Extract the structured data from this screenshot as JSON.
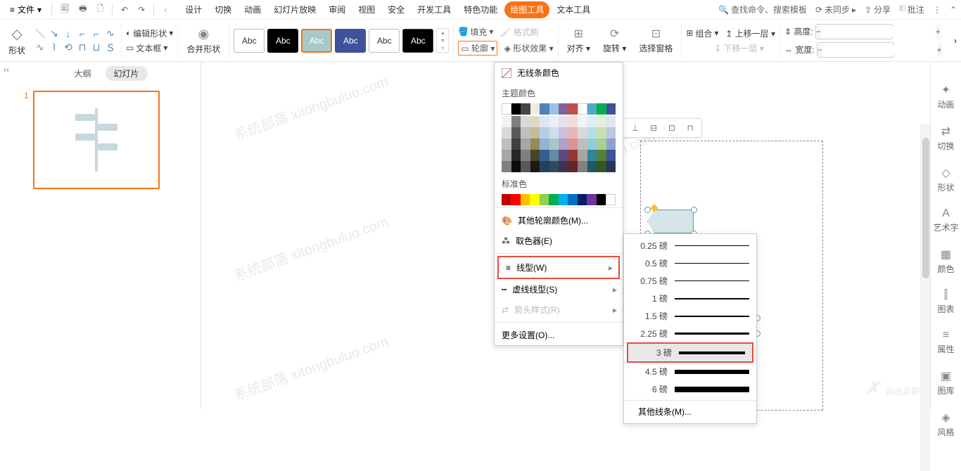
{
  "menubar": {
    "file": "文件",
    "tabs": [
      "设计",
      "切换",
      "动画",
      "幻灯片放映",
      "审阅",
      "视图",
      "安全",
      "开发工具",
      "特色功能",
      "绘图工具",
      "文本工具"
    ],
    "active_tab_index": 9,
    "search": "查找命令、搜索模板",
    "unsynced": "未同步",
    "share": "分享",
    "annotate": "批注"
  },
  "ribbon": {
    "shape_label": "形状",
    "edit_shape": "编辑形状",
    "text_box": "文本框",
    "merge_shapes": "合并形状",
    "style_text": "Abc",
    "fill": "填充",
    "format_painter": "格式刷",
    "outline": "轮廓",
    "shape_effects": "形状效果",
    "align": "对齐",
    "rotate": "旋转",
    "select_pane": "选择窗格",
    "group": "组合",
    "bring_forward": "上移一层",
    "send_backward": "下移一层",
    "height": "高度:",
    "width": "宽度:",
    "height_val": "",
    "width_val": ""
  },
  "left": {
    "tabs": {
      "outline": "大纲",
      "slides": "幻灯片"
    },
    "slide_num": "1"
  },
  "outline_menu": {
    "no_line": "无线条颜色",
    "theme_colors": "主题颜色",
    "theme_row": [
      "#ffffff",
      "#000000",
      "#464646",
      "#eeece1",
      "#4f81bd",
      "#9bc2e6",
      "#8064a2",
      "#c0504d",
      "#ffffff",
      "#4bacc6",
      "#00b050",
      "#3d529a"
    ],
    "variants": [
      [
        "#f2f2f2",
        "#7f7f7f",
        "#d9d9d9",
        "#ddd9c3",
        "#dce6f1",
        "#e7eff7",
        "#e6e0ec",
        "#f2dcdb",
        "#f2f2f2",
        "#dbeef3",
        "#e2efda",
        "#dfe4f0"
      ],
      [
        "#d9d9d9",
        "#595959",
        "#bfbfbf",
        "#c4bd97",
        "#b8cce4",
        "#cedeeb",
        "#ccc0da",
        "#e5b8b7",
        "#d9d9d9",
        "#b7dee8",
        "#c6e0b4",
        "#bcc6e0"
      ],
      [
        "#bfbfbf",
        "#404040",
        "#a6a6a6",
        "#948a54",
        "#95b3d7",
        "#a7c8c8",
        "#b1a0c7",
        "#d99694",
        "#bfbfbf",
        "#92cddc",
        "#a9d08e",
        "#8fa0cb"
      ],
      [
        "#a6a6a6",
        "#262626",
        "#808080",
        "#494529",
        "#366092",
        "#608da9",
        "#60497a",
        "#953734",
        "#a6a6a6",
        "#31859b",
        "#548235",
        "#3d529a"
      ],
      [
        "#808080",
        "#0d0d0d",
        "#595959",
        "#1d1b10",
        "#244061",
        "#2f4b5b",
        "#3f3151",
        "#632423",
        "#808080",
        "#205867",
        "#375623",
        "#27355f"
      ]
    ],
    "standard": "标准色",
    "standard_row": [
      "#c00000",
      "#ff0000",
      "#ffc000",
      "#ffff00",
      "#92d050",
      "#00b050",
      "#00b0f0",
      "#0070c0",
      "#002060",
      "#7030a0",
      "#000000",
      "#ffffff"
    ],
    "more_colors": "其他轮廓颜色(M)...",
    "eyedropper": "取色器(E)",
    "weight": "线型(W)",
    "dashes": "虚线线型(S)",
    "arrows": "箭头样式(R)",
    "more_settings": "更多设置(O)..."
  },
  "weights": {
    "items": [
      {
        "label": "0.25 磅",
        "px": 1
      },
      {
        "label": "0.5 磅",
        "px": 1
      },
      {
        "label": "0.75 磅",
        "px": 1
      },
      {
        "label": "1 磅",
        "px": 2
      },
      {
        "label": "1.5 磅",
        "px": 2
      },
      {
        "label": "2.25 磅",
        "px": 3
      },
      {
        "label": "3 磅",
        "px": 4
      },
      {
        "label": "4.5 磅",
        "px": 6
      },
      {
        "label": "6 磅",
        "px": 8
      }
    ],
    "selected_index": 6,
    "more": "其他线条(M)..."
  },
  "right_panel": [
    "动画",
    "切换",
    "形状",
    "艺术字",
    "颜色",
    "图表",
    "属性",
    "图库",
    "风格"
  ],
  "watermark_text": "系统部落 xitongbuluo.com",
  "brand_watermark": "自由互联"
}
